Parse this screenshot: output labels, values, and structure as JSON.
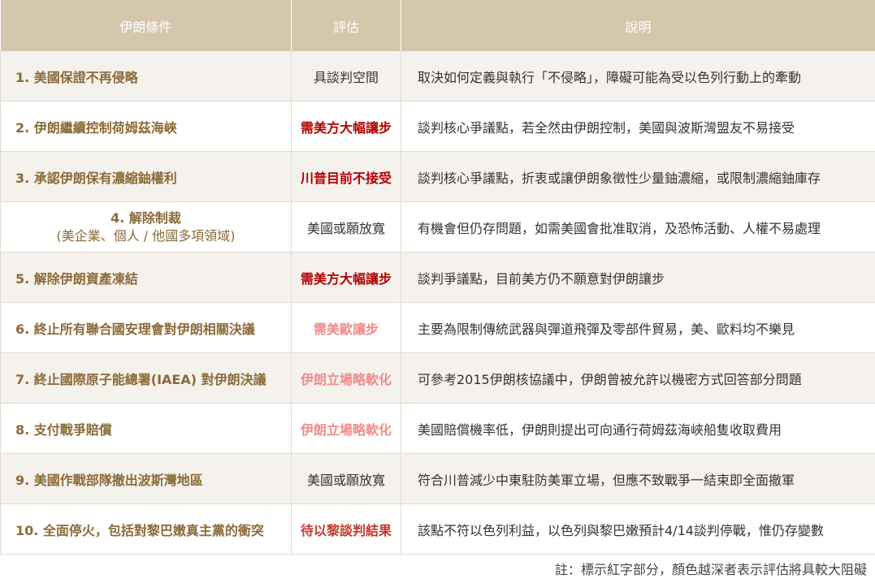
{
  "headers": [
    "伊朗條件",
    "評估",
    "說明"
  ],
  "rows": [
    {
      "cond": "1. 美國保證不再侵略",
      "eval": "具談判空間",
      "desc": "取決如何定義與執行「不侵略」，障礙可能為受以色列行動上的牽動"
    },
    {
      "cond": "2. 伊朗繼續控制荷姆茲海峽",
      "eval": "需美方大幅讓步",
      "desc": "談判核心爭議點，若全然由伊朗控制，美國與波斯灣盟友不易接受"
    },
    {
      "cond": "3. 承認伊朗保有濃縮鈾權利",
      "eval": "川普目前不接受",
      "desc": "談判核心爭議點，折衷或讓伊朗象徵性少量鈾濃縮，或限制濃縮鈾庫存"
    },
    {
      "cond": "4. 解除制裁",
      "cond_sub": "(美企業、個人 / 他國多項領域)",
      "eval": "美國或願放寬",
      "desc": "有機會但仍存問題，如需美國會批准取消，及恐怖活動、人權不易處理"
    },
    {
      "cond": "5. 解除伊朗資產凍結",
      "eval": "需美方大幅讓步",
      "desc": "談判爭議點，目前美方仍不願意對伊朗讓步"
    },
    {
      "cond": "6. 終止所有聯合國安理會對伊朗相關決議",
      "eval": "需美歐讓步",
      "desc": "主要為限制傳統武器與彈道飛彈及零部件貿易，美、歐料均不樂見"
    },
    {
      "cond": "7. 終止國際原子能總署(IAEA) 對伊朗決議",
      "eval": "伊朗立場略軟化",
      "desc": "可參考2015伊朗核協議中，伊朗曾被允許以機密方式回答部分問題"
    },
    {
      "cond": "8. 支付戰爭賠償",
      "eval": "伊朗立場略軟化",
      "desc": "美國賠償機率低，伊朗則提出可向通行荷姆茲海峽船隻收取費用"
    },
    {
      "cond": "9. 美國作戰部隊撤出波斯灣地區",
      "eval": "美國或願放寬",
      "desc": "符合川普減少中東駐防美軍立場，但應不致戰爭一結束即全面撤軍"
    },
    {
      "cond": "10. 全面停火，包括對黎巴嫩真主黨的衝突",
      "eval": "待以黎談判結果",
      "desc": "該點不符以色列利益，以色列與黎巴嫩預計4/14談判停戰，惟仍存變數"
    }
  ],
  "note": "註：標示紅字部分，顏色越深者表示評估將具較大阻礙",
  "colors": {
    "header_bg": "#d5c7ab",
    "condition_text": "#8b6a38",
    "red_strong": "#b40000",
    "red_light": "#f08a8a"
  }
}
